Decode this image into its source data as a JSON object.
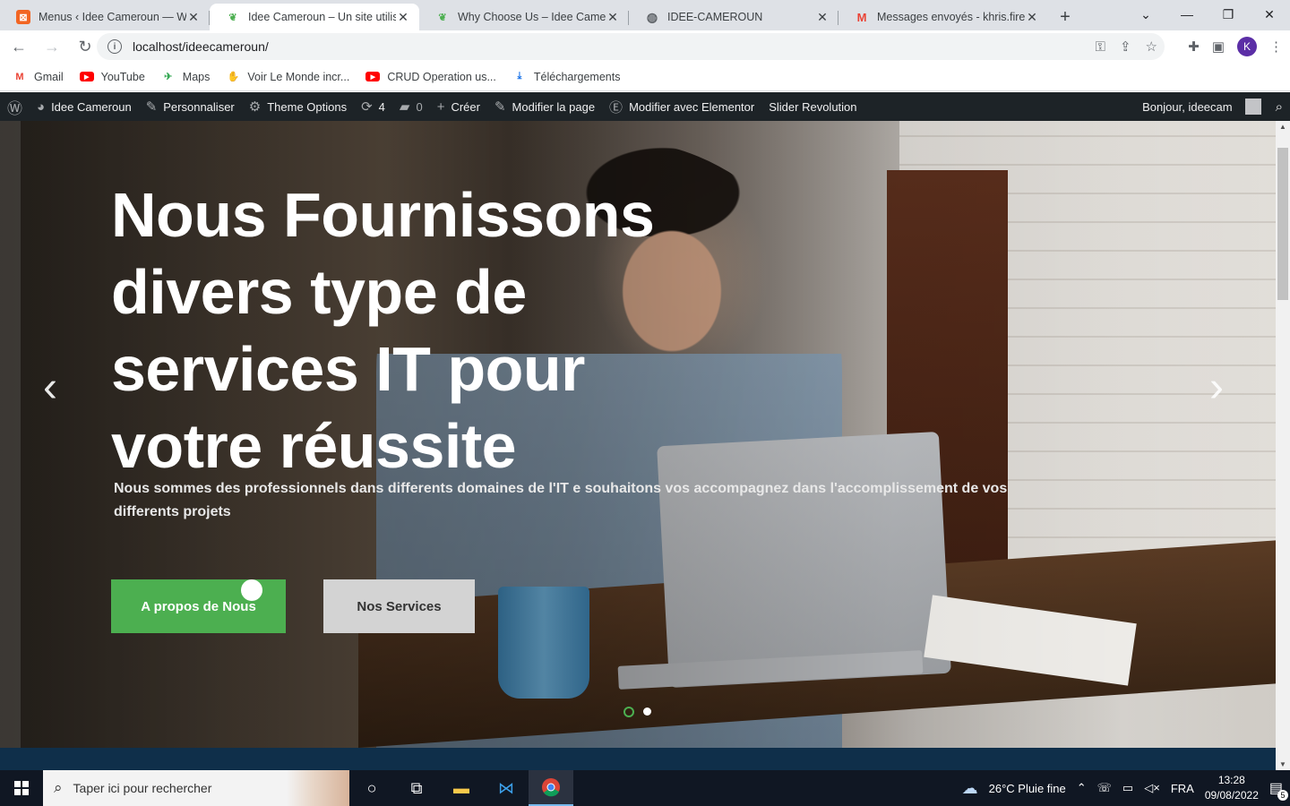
{
  "browser": {
    "tabs": [
      {
        "title": "Menus ‹ Idee Cameroun — Wor",
        "icon": "wp-admin-icon"
      },
      {
        "title": "Idee Cameroun – Un site utilisan",
        "icon": "leaf-icon"
      },
      {
        "title": "Why Choose Us – Idee Camerou",
        "icon": "leaf-icon"
      },
      {
        "title": "IDEE-CAMEROUN",
        "icon": "globe-icon"
      },
      {
        "title": "Messages envoyés - khris.fireso",
        "icon": "gmail-icon"
      }
    ],
    "url": "localhost/ideecameroun/",
    "profile_initial": "K"
  },
  "bookmarks": [
    {
      "label": "Gmail",
      "icon": "gmail-icon"
    },
    {
      "label": "YouTube",
      "icon": "youtube-icon"
    },
    {
      "label": "Maps",
      "icon": "maps-icon"
    },
    {
      "label": "Voir Le Monde incr...",
      "icon": "hand-icon"
    },
    {
      "label": "CRUD Operation us...",
      "icon": "youtube-icon"
    },
    {
      "label": "Téléchargements",
      "icon": "download-icon"
    }
  ],
  "adminbar": {
    "site": "Idee Cameroun",
    "customize": "Personnaliser",
    "theme_options": "Theme Options",
    "updates": "4",
    "comments": "0",
    "new": "Créer",
    "edit_page": "Modifier la page",
    "elementor": "Modifier avec Elementor",
    "slider": "Slider Revolution",
    "greeting": "Bonjour, ideecam"
  },
  "hero": {
    "title": "Nous Fournissons divers type de services IT pour votre réussite",
    "subtitle": "Nous sommes des professionnels dans differents domaines de l'IT e souhaitons vos accompagnez dans l'accomplissement de vos differents projets",
    "btn_about": "A propos de Nous",
    "btn_services": "Nos Services",
    "accent": "#4caf50"
  },
  "taskbar": {
    "search_placeholder": "Taper ici pour rechercher",
    "weather": "26°C  Pluie fine",
    "lang": "FRA",
    "time": "13:28",
    "date": "09/08/2022",
    "notifications": "5"
  }
}
